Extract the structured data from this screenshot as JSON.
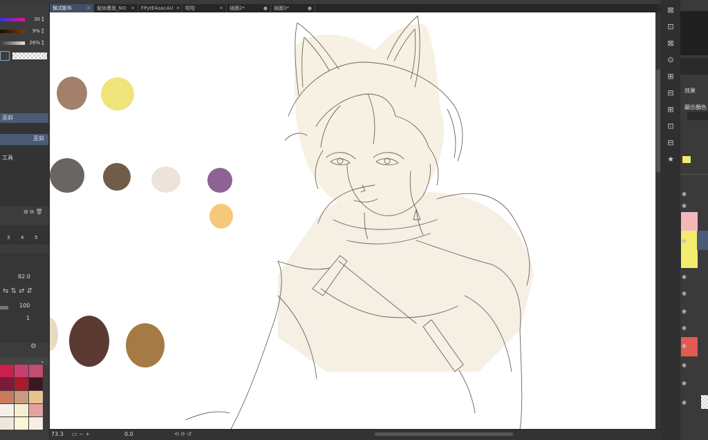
{
  "tabs": [
    {
      "label": "鬚式斷布",
      "active": true
    },
    {
      "label": "髮絲畫面_NO"
    },
    {
      "label": "FPytE4aacAU"
    },
    {
      "label": "啦啦"
    },
    {
      "label": "插圖2*"
    },
    {
      "label": "插圖3*"
    }
  ],
  "left_panel": {
    "sliders": [
      {
        "value": "30",
        "color": "#e0188c"
      },
      {
        "value": "9%",
        "color": "#7a3a16"
      },
      {
        "value": "26%",
        "color": "#c9c2b4"
      }
    ],
    "subtool_label": "歪斜",
    "subtool_selected": "歪斜",
    "tool_label": "工具",
    "brush_sizes": [
      "3",
      "4",
      "5"
    ],
    "opacity_value": "82.0",
    "density_value": "100",
    "count_value": "1",
    "palette_swatches": [
      "#cc1f4a",
      "#c83e6e",
      "#c24d73",
      "#7d1a3a",
      "#a81a2c",
      "#3b1820",
      "#c87c59",
      "#c89a7e",
      "#e7c48e",
      "#f6efe8",
      "#f5eed0",
      "#e3a2a2",
      "#efe7dd",
      "#fbf6d8",
      "#f4f0e4"
    ]
  },
  "status": {
    "zoom": "73.3",
    "angle": "0.0"
  },
  "right_panel": {
    "effect_label": "效果",
    "display_color_label": "顯示顏色"
  },
  "colors": {
    "canvas_swatches": [
      "#a3806c",
      "#efe47a",
      "#6a6462",
      "#715c48",
      "#ede3d9",
      "#8e6295",
      "#f5c97a",
      "#5b3a34",
      "#a57a45",
      "#e7dbc4"
    ],
    "layer_pink": "#f4b8b8",
    "layer_yellow": "#f4ec6e",
    "layer_red": "#e25a52",
    "accent": "#414e66"
  }
}
